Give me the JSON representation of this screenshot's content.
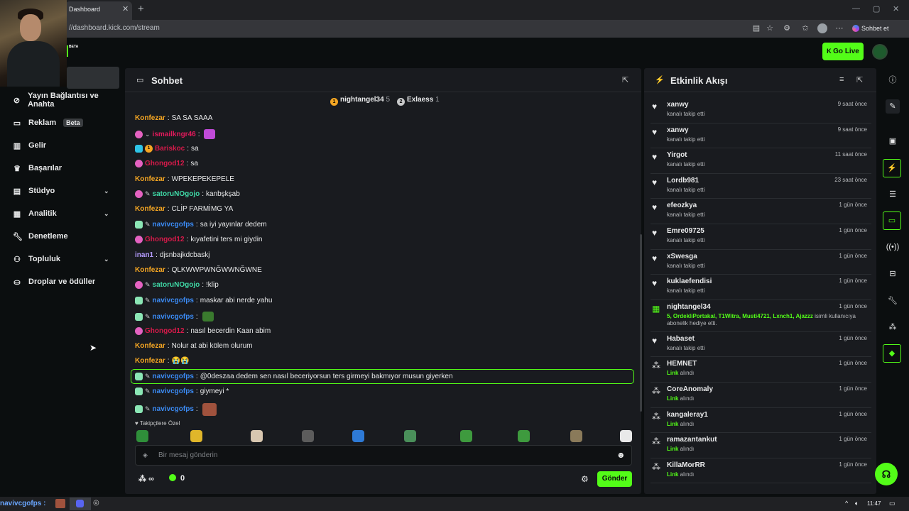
{
  "browser": {
    "tab_title": "Dashboard",
    "url": "//dashboard.kick.com/stream",
    "copilot_label": "Sohbet et"
  },
  "header": {
    "beta_tag": "BETA",
    "go_live_label": "Go Live"
  },
  "sidebar": {
    "items": [
      {
        "label": "Yayın Bağlantısı ve Anahta",
        "icon": "link-icon",
        "chevron": false
      },
      {
        "label": "Reklam",
        "icon": "ad-icon",
        "badge": "Beta",
        "chevron": false
      },
      {
        "label": "Gelir",
        "icon": "revenue-icon",
        "chevron": false
      },
      {
        "label": "Başarılar",
        "icon": "trophy-icon",
        "chevron": false
      },
      {
        "label": "Stüdyo",
        "icon": "studio-icon",
        "chevron": true
      },
      {
        "label": "Analitik",
        "icon": "analytics-icon",
        "chevron": true
      },
      {
        "label": "Denetleme",
        "icon": "wrench-icon",
        "chevron": false
      },
      {
        "label": "Topluluk",
        "icon": "community-icon",
        "chevron": true
      },
      {
        "label": "Droplar ve ödüller",
        "icon": "drops-icon",
        "chevron": false
      }
    ]
  },
  "chat": {
    "title": "Sohbet",
    "top_gifters": [
      {
        "name": "nightangel34",
        "count": "5"
      },
      {
        "name": "Exlaess",
        "count": "1"
      }
    ],
    "messages": [
      {
        "user": "Konfezar",
        "color": "#f5a623",
        "text": "SA SA SAAA",
        "badges": []
      },
      {
        "user": "ismailkngr46",
        "color": "#e2195b",
        "text": "",
        "badges": [
          "sub",
          "chev"
        ],
        "emote": "#c04bd8"
      },
      {
        "user": "Bariskoc",
        "color": "#d61a4a",
        "text": "sa",
        "badges": [
          "vip",
          "og"
        ]
      },
      {
        "user": "Ghongod12",
        "color": "#d61a4a",
        "text": "sa",
        "badges": [
          "sub"
        ]
      },
      {
        "user": "Konfezar",
        "color": "#f5a623",
        "text": "WPEKEPEKEPELE",
        "badges": []
      },
      {
        "user": "satoruNOgojo",
        "color": "#3fd9a6",
        "text": "kanbşkşab",
        "badges": [
          "sub",
          "pencil"
        ]
      },
      {
        "user": "Konfezar",
        "color": "#f5a623",
        "text": "CLİP FARMİMG YA",
        "badges": []
      },
      {
        "user": "navivcgofps",
        "color": "#3b8bf5",
        "text": "sa iyi yayınlar dedem",
        "badges": [
          "mod",
          "pencil"
        ]
      },
      {
        "user": "Ghongod12",
        "color": "#d61a4a",
        "text": "kıyafetini ters mi giydin",
        "badges": [
          "sub"
        ]
      },
      {
        "user": "inan1",
        "color": "#b59cff",
        "text": "djsnbajkdcbaskj",
        "badges": []
      },
      {
        "user": "Konfezar",
        "color": "#f5a623",
        "text": "QLKWWPWNĞWWNĞWNE",
        "badges": []
      },
      {
        "user": "satoruNOgojo",
        "color": "#3fd9a6",
        "text": "!klip",
        "badges": [
          "sub",
          "pencil"
        ]
      },
      {
        "user": "navivcgofps",
        "color": "#3b8bf5",
        "text": "maskar abi nerde yahu",
        "badges": [
          "mod",
          "pencil"
        ]
      },
      {
        "user": "navivcgofps",
        "color": "#3b8bf5",
        "text": "",
        "badges": [
          "mod",
          "pencil"
        ],
        "emote": "#3a7a2e"
      },
      {
        "user": "Ghongod12",
        "color": "#d61a4a",
        "text": "nasıl becerdin Kaan abim",
        "badges": [
          "sub"
        ]
      },
      {
        "user": "Konfezar",
        "color": "#f5a623",
        "text": "Nolur at abi kölem olurum",
        "badges": []
      },
      {
        "user": "Konfezar",
        "color": "#f5a623",
        "text": "😭😭",
        "badges": []
      },
      {
        "user": "navivcgofps",
        "color": "#3b8bf5",
        "text": "@0deszaa dedem sen nasıl beceriyorsun ters girmeyi bakmıyor musun giyerken",
        "badges": [
          "mod",
          "pencil"
        ]
      },
      {
        "user": "navivcgofps",
        "color": "#3b8bf5",
        "text": "giymeyi *",
        "badges": [
          "mod",
          "pencil"
        ]
      },
      {
        "user": "navivcgofps",
        "color": "#3b8bf5",
        "text": "",
        "badges": [
          "mod",
          "pencil"
        ],
        "emote": "#a0523d"
      }
    ],
    "followers_only_label": "Takipçilere Özel",
    "emote_colors": [
      "#2f8f3a",
      "#e0b62a",
      "#d8c7b0",
      "#5c5c5c",
      "#2e7ad6",
      "#4a8f5a",
      "#3e9a3e",
      "#3e9a3e",
      "#8a7a5a",
      "#e9e9e9"
    ],
    "input_placeholder": "Bir mesaj gönderin",
    "points_value": "∞",
    "coins_value": "0",
    "send_label": "Gönder"
  },
  "activity": {
    "title": "Etkinlik Akışı",
    "events": [
      {
        "type": "follow",
        "icon": "heart-icon",
        "name": "xanwy",
        "desc": "kanalı takip etti",
        "time": "9 saat önce"
      },
      {
        "type": "follow",
        "icon": "heart-icon",
        "name": "xanwy",
        "desc": "kanalı takip etti",
        "time": "9 saat önce"
      },
      {
        "type": "follow",
        "icon": "heart-icon",
        "name": "Yirgot",
        "desc": "kanalı takip etti",
        "time": "11 saat önce"
      },
      {
        "type": "follow",
        "icon": "heart-icon",
        "name": "Lordb981",
        "desc": "kanalı takip etti",
        "time": "23 saat önce"
      },
      {
        "type": "follow",
        "icon": "heart-icon",
        "name": "efeozkya",
        "desc": "kanalı takip etti",
        "time": "1 gün önce"
      },
      {
        "type": "follow",
        "icon": "heart-icon",
        "name": "Emre09725",
        "desc": "kanalı takip etti",
        "time": "1 gün önce"
      },
      {
        "type": "follow",
        "icon": "heart-icon",
        "name": "xSwesga",
        "desc": "kanalı takip etti",
        "time": "1 gün önce"
      },
      {
        "type": "follow",
        "icon": "heart-icon",
        "name": "kuklaefendisi",
        "desc": "kanalı takip etti",
        "time": "1 gün önce"
      },
      {
        "type": "gift",
        "icon": "gift-icon",
        "name": "nightangel34",
        "desc_green": "5, OrdekliPortakal, T1Witra, Musti4721, Lxnch1, Ajazzz",
        "desc": " isimli kullanıcıya",
        "desc2": "abonelik hediye etti.",
        "time": "1 gün önce"
      },
      {
        "type": "follow",
        "icon": "heart-icon",
        "name": "Habaset",
        "desc": "kanalı takip etti",
        "time": "1 gün önce"
      },
      {
        "type": "link",
        "icon": "link-reward-icon",
        "name": "HEMNET",
        "desc_green": "Link",
        "desc": " alındı",
        "time": "1 gün önce"
      },
      {
        "type": "link",
        "icon": "link-reward-icon",
        "name": "CoreAnomaly",
        "desc_green": "Link",
        "desc": " alındı",
        "time": "1 gün önce"
      },
      {
        "type": "link",
        "icon": "link-reward-icon",
        "name": "kangaleray1",
        "desc_green": "Link",
        "desc": " alındı",
        "time": "1 gün önce"
      },
      {
        "type": "link",
        "icon": "link-reward-icon",
        "name": "ramazantankut",
        "desc_green": "Link",
        "desc": " alındı",
        "time": "1 gün önce"
      },
      {
        "type": "link",
        "icon": "link-reward-icon",
        "name": "KillaMorRR",
        "desc_green": "Link",
        "desc": " alındı",
        "time": "1 gün önce"
      }
    ]
  },
  "taskbar": {
    "app_label": "navivcgofps :",
    "clock": "11:47"
  },
  "colors": {
    "accent": "#53fc18",
    "panel": "#191b1f",
    "background": "#0b0e0f"
  }
}
